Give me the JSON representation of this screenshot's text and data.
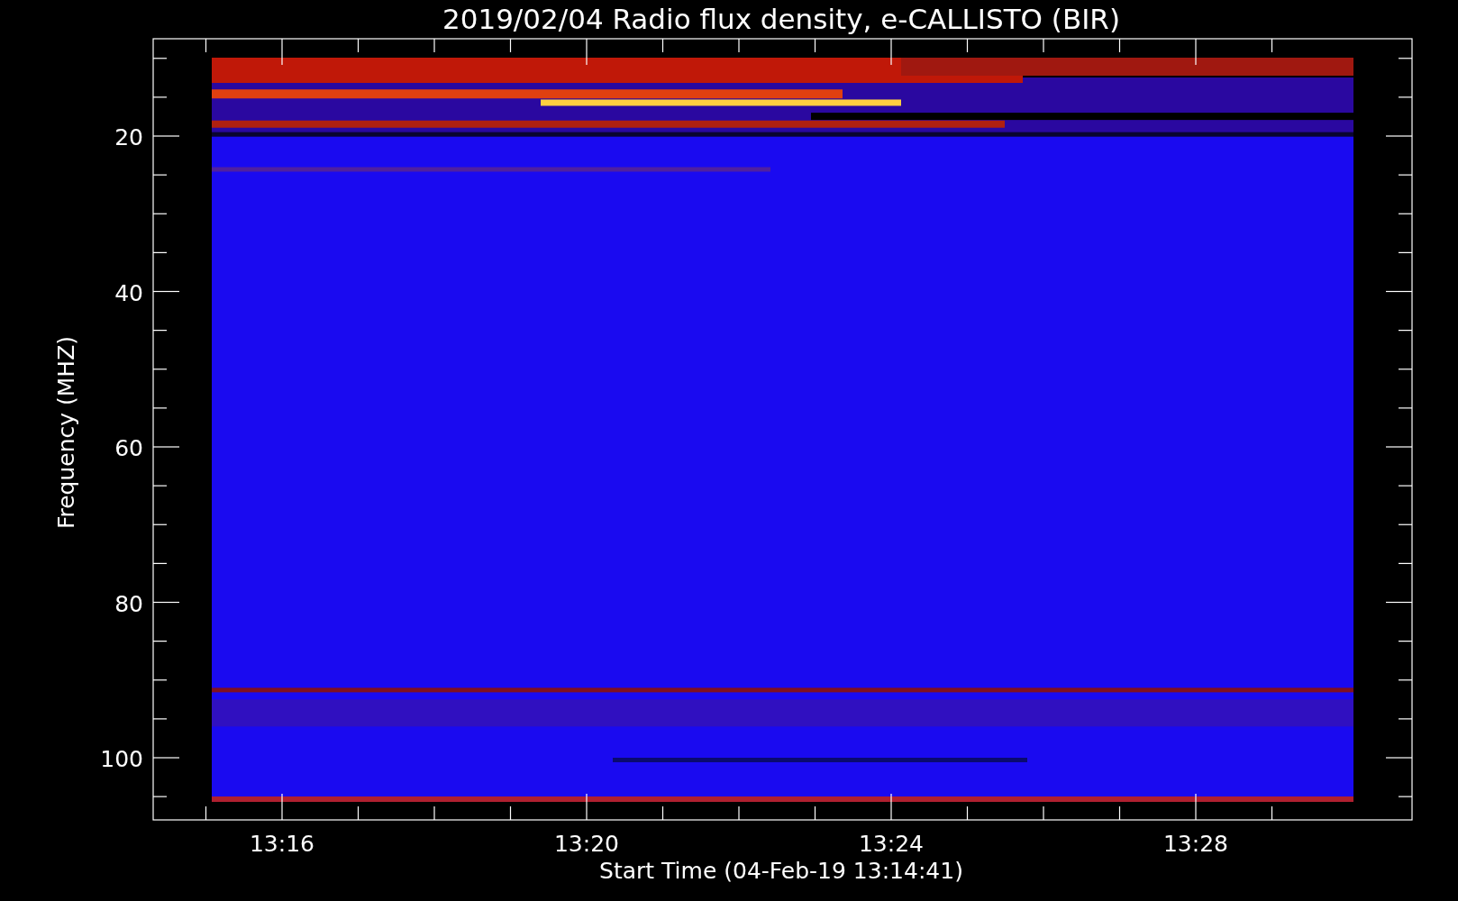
{
  "title": "2019/02/04  Radio flux density, e-CALLISTO (BIR)",
  "y_axis": {
    "label": "Frequency (MHZ)",
    "ticks": [
      "20",
      "40",
      "60",
      "80",
      "100"
    ]
  },
  "x_axis": {
    "label": "Start Time (04-Feb-19 13:14:41)",
    "ticks": [
      "13:16",
      "13:20",
      "13:24",
      "13:28"
    ]
  }
}
